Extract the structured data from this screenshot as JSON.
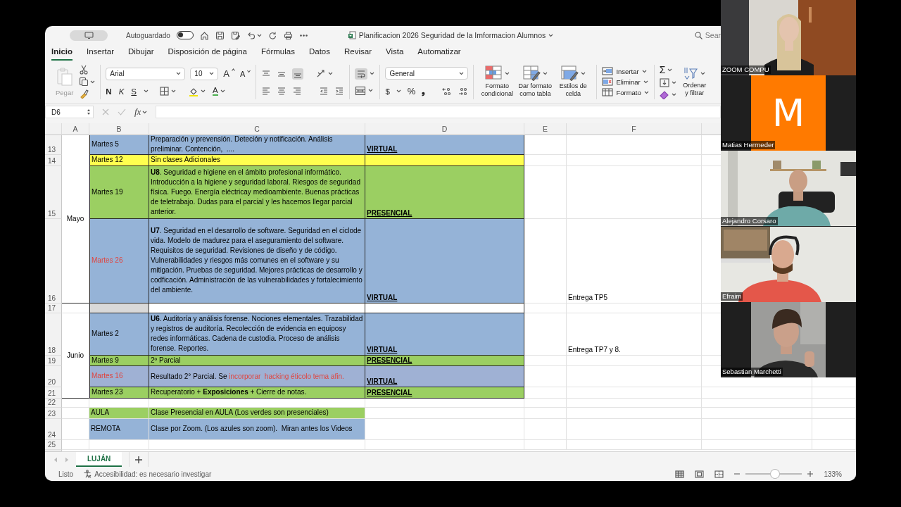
{
  "window": {
    "title": "Planificacion 2026 Seguridad de la Imformacion Alumnos",
    "autosave_label": "Autoguardado",
    "autosave": false,
    "search": "Sear"
  },
  "ribbon_tabs": [
    {
      "label": "Inicio",
      "selected": true
    },
    {
      "label": "Insertar",
      "selected": false
    },
    {
      "label": "Dibujar",
      "selected": false
    },
    {
      "label": "Disposición de página",
      "selected": false
    },
    {
      "label": "Fórmulas",
      "selected": false
    },
    {
      "label": "Datos",
      "selected": false
    },
    {
      "label": "Revisar",
      "selected": false
    },
    {
      "label": "Vista",
      "selected": false
    },
    {
      "label": "Automatizar",
      "selected": false
    }
  ],
  "ribbon": {
    "paste": {
      "label": "Pegar",
      "disabled": true
    },
    "font": "Arial",
    "font_size": "10",
    "font_size_buttons": [
      "A",
      "A"
    ],
    "style_buttons": [
      "N",
      "K",
      "S"
    ],
    "font_color": "A",
    "align_bottom": true,
    "wrap_text": true,
    "number_format": "General",
    "number_buttons": [
      "$",
      "%",
      "❟"
    ],
    "styles": [
      "Formato condicional",
      "Dar formato como tabla",
      "Estilos de celda"
    ],
    "cells": [
      "Insertar",
      "Eliminar",
      "Formato"
    ],
    "autosum": "Σ",
    "sort": "Ordenar y filtrar"
  },
  "formula_bar": {
    "cell": "D6",
    "function_label": "fx"
  },
  "sheet": {
    "columns": [
      "A",
      "B",
      "C",
      "D",
      "E",
      "F"
    ],
    "blocks": [
      {
        "month": "Mayo",
        "framed": true,
        "rows": [
          {
            "number": "13",
            "b": {
              "text": "Martes 5",
              "color": "#95b3d7",
              "highlighted": false
            },
            "c": {
              "text": "Preparación y prevensión. Deteción y notificación. Análisis preliminar. Contención,  ....",
              "color": "#95b3d7"
            },
            "d": {
              "text": "VIRTUAL",
              "color": "#95b3d7"
            }
          },
          {
            "number": "14",
            "b": {
              "text": "Martes 12",
              "color": "#ffff4f",
              "highlighted": false
            },
            "c": {
              "text": "Sin clases Adicionales",
              "color": "#ffff4f"
            },
            "d": {
              "color": "#ffff4f"
            }
          },
          {
            "number": "15",
            "b": {
              "text": "Martes 19",
              "color": "#9bcf62",
              "highlighted": false
            },
            "c": {
              "text": "**U8**. Seguridad e higiene en el ámbito profesional informático. Introducción a la higiene y seguridad laboral. Riesgos de seguridad física. Fuego. Energía eléctricay medioambiente. Buenas prácticas de teletrabajo. Dudas para el parcial y les hacemos llegar parcial anterior.",
              "color": "#9bcf62"
            },
            "d": {
              "text": "PRESENCIAL",
              "color": "#9bcf62"
            }
          },
          {
            "number": "16",
            "b": {
              "text": "Martes 26",
              "color": "#95b3d7",
              "highlighted": true
            },
            "c": {
              "text": "**U7**. Seguridad en el desarrollo de software. Seguridad en el ciclode vida. Modelo de madurez para el aseguramiento del software. Requisitos de seguridad. Revisiones de diseño y de código. Vulnerabilidades y riesgos más comunes en el software y su mitigación. Pruebas de seguridad. Mejores prácticas de desarrollo y codficación. Administración de las vulnerabilidades y fortalecimiento del ambiente.",
              "color": "#95b3d7"
            },
            "d": {
              "text": "VIRTUAL",
              "color": "#95b3d7"
            },
            "f": "Entrega TP5"
          }
        ]
      },
      {
        "framed": true,
        "rows": [
          {
            "number": "17",
            "b": {
              "color": "#d9d9d9"
            }
          }
        ]
      },
      {
        "month": "Junio",
        "framed": true,
        "rows": [
          {
            "number": "18",
            "b": {
              "text": "Martes 2",
              "color": "#95b3d7",
              "highlighted": false
            },
            "c": {
              "text": "**U6**. Auditoría y análisis forense. Nociones elementales. Trazabilidad y registros de auditoría. Recolección de evidencia en equiposy redes informáticas. Cadena de custodia. Proceso de análisis forense. Reportes.",
              "color": "#95b3d7"
            },
            "d": {
              "text": "VIRTUAL",
              "color": "#95b3d7"
            },
            "f": "Entrega TP7 y 8."
          },
          {
            "number": "19",
            "b": {
              "text": "Martes 9",
              "color": "#9bcf62",
              "highlighted": false
            },
            "c": {
              "text": "2º Parcial",
              "color": "#9bcf62"
            },
            "d": {
              "text": "PRESENCIAL",
              "color": "#9bcf62"
            }
          },
          {
            "number": "20",
            "b": {
              "text": "Martes 16",
              "color": "#9fb1d4",
              "highlighted": true
            },
            "c": {
              "text": "Resultado 2° Parcial. Se",
              "color": "#9fb1d4",
              "note": {
                "text": "incorporar  hacking éticolo tema afin."
              }
            },
            "d": {
              "text": "VIRTUAL",
              "color": "#9fb1d4"
            }
          },
          {
            "number": "21",
            "b": {
              "text": "Martes 23",
              "color": "#9bcf62",
              "highlighted": false
            },
            "c": {
              "text": "Recuperatorio + **Exposiciones** + Cierre de notas.",
              "color": "#9bcf62"
            },
            "d": {
              "text": "PRESENCIAL",
              "color": "#9bcf62"
            }
          }
        ]
      },
      {
        "framed": false,
        "rows": [
          {
            "number": "22"
          },
          {
            "number": "23",
            "b": {
              "text": "AULA",
              "color": "#9bcf62",
              "highlighted": false
            },
            "c": {
              "text": "Clase Presencial en AULA (Los verdes son presenciales)",
              "color": "#9bcf62"
            }
          },
          {
            "number": "24",
            "b": {
              "text": "REMOTA",
              "color": "#95b3d7",
              "highlighted": false
            },
            "c": {
              "text": "Clase por Zoom. (Los azules son zoom).  Miran antes los Videos",
              "color": "#95b3d7"
            }
          },
          {
            "number": "25"
          }
        ]
      }
    ]
  },
  "sheet_tabs": [
    {
      "label": "LUJÁN",
      "selected": true
    }
  ],
  "status_bar": {
    "text": "Listo",
    "accessibility": "Accesibilidad: es necesario investigar",
    "zoom": "133%",
    "zoom_slider": {
      "level": 0.52
    }
  },
  "meeting": {
    "participants": [
      {
        "name": "ZOOM COMPU",
        "kind": "video"
      },
      {
        "name": "Matias Herrneder",
        "kind": "avatar",
        "initial": "M"
      },
      {
        "name": "Alejandro Corsaro",
        "kind": "video"
      },
      {
        "name": "Efraim",
        "kind": "video"
      },
      {
        "name": "Sebastian Marchetti",
        "kind": "narrow_video"
      }
    ]
  }
}
